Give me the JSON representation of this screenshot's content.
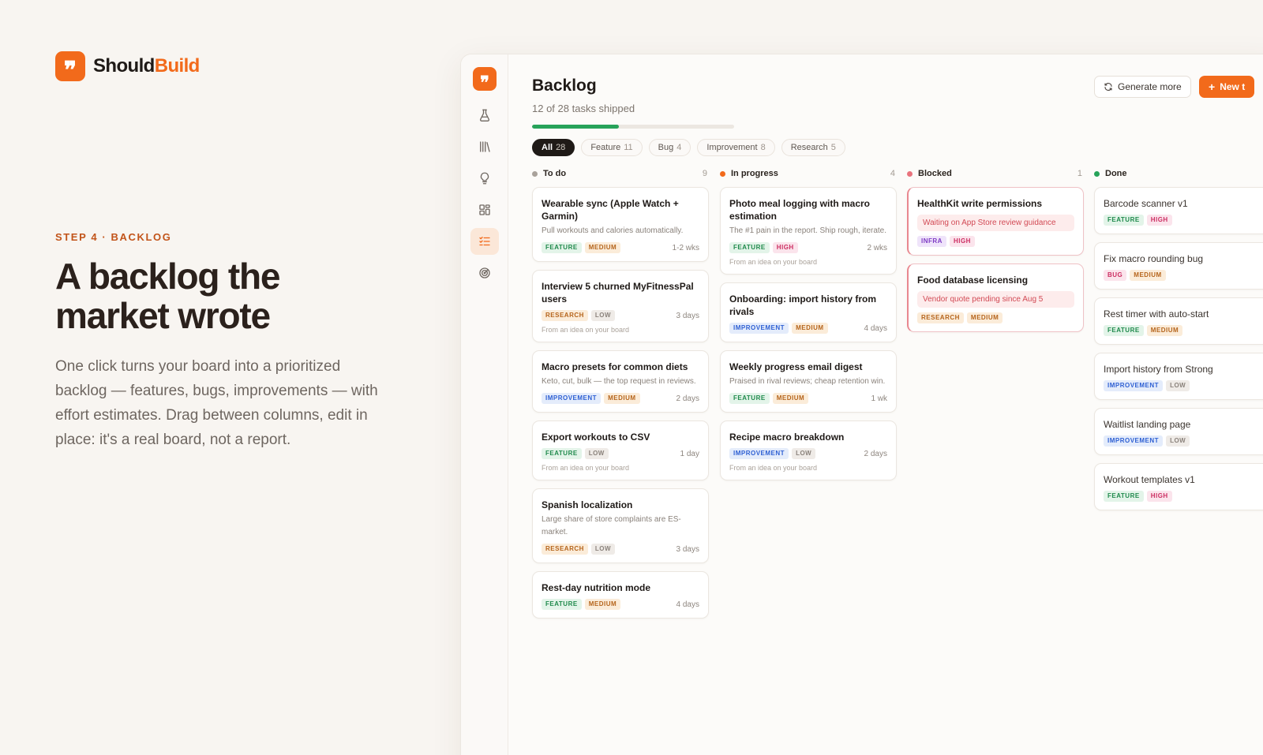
{
  "brand": {
    "name_main": "Should",
    "name_accent": "Build",
    "logo_glyph": "❞"
  },
  "hero": {
    "step": "STEP 4 · BACKLOG",
    "headline": "A backlog the market wrote",
    "lead": "One click turns your board into a prioritized backlog — features, bugs, improvements — with effort estimates. Drag between columns, edit in place: it's a real board, not a report."
  },
  "rail": {
    "logo_glyph": "❞",
    "items": [
      {
        "name": "rail-experiments",
        "icon": "flask-icon",
        "active": false
      },
      {
        "name": "rail-library",
        "icon": "library-icon",
        "active": false
      },
      {
        "name": "rail-ideas",
        "icon": "lightbulb-icon",
        "active": false
      },
      {
        "name": "rail-board",
        "icon": "grid-icon",
        "active": false
      },
      {
        "name": "rail-backlog",
        "icon": "checklist-icon",
        "active": true
      },
      {
        "name": "rail-radar",
        "icon": "radar-icon",
        "active": false
      }
    ]
  },
  "backlog": {
    "title": "Backlog",
    "subtitle": "12 of 28 tasks shipped",
    "shipped": 12,
    "total": 28,
    "generate_label": "Generate more",
    "new_label": "New t",
    "filters": [
      {
        "label": "All",
        "count": "28",
        "active": true
      },
      {
        "label": "Feature",
        "count": "11",
        "active": false
      },
      {
        "label": "Bug",
        "count": "4",
        "active": false
      },
      {
        "label": "Improvement",
        "count": "8",
        "active": false
      },
      {
        "label": "Research",
        "count": "5",
        "active": false
      }
    ]
  },
  "colors": {
    "accent": "#f26a1b",
    "badges": {
      "FEATURE": {
        "fg": "#1f8a4c",
        "bg": "#e3f4e9"
      },
      "RESEARCH": {
        "fg": "#b5641b",
        "bg": "#fbecd9"
      },
      "IMPROVEMENT": {
        "fg": "#2d5fd3",
        "bg": "#e4ecfb"
      },
      "BUG": {
        "fg": "#cc2e62",
        "bg": "#fbe4ec"
      },
      "INFRA": {
        "fg": "#7d3ac4",
        "bg": "#efe4fa"
      },
      "MEDIUM": {
        "fg": "#b5641b",
        "bg": "#fbecd9"
      },
      "LOW": {
        "fg": "#8a827b",
        "bg": "#efebe7"
      },
      "HIGH": {
        "fg": "#cc2e62",
        "bg": "#fbe4ec"
      }
    }
  },
  "columns": [
    {
      "key": "todo",
      "name": "To do",
      "count": "9",
      "dot": "#a9a29b",
      "cards": [
        {
          "title": "Wearable sync (Apple Watch + Garmin)",
          "desc": "Pull workouts and calories automatically.",
          "tags": [
            "FEATURE",
            "MEDIUM"
          ],
          "effort": "1-2 wks"
        },
        {
          "title": "Interview 5 churned MyFitnessPal users",
          "tags": [
            "RESEARCH",
            "LOW"
          ],
          "effort": "3 days",
          "source": "From an idea on your board"
        },
        {
          "title": "Macro presets for common diets",
          "desc": "Keto, cut, bulk — the top request in reviews.",
          "tags": [
            "IMPROVEMENT",
            "MEDIUM"
          ],
          "effort": "2 days"
        },
        {
          "title": "Export workouts to CSV",
          "tags": [
            "FEATURE",
            "LOW"
          ],
          "effort": "1 day",
          "source": "From an idea on your board"
        },
        {
          "title": "Spanish localization",
          "desc": "Large share of store complaints are ES-market.",
          "tags": [
            "RESEARCH",
            "LOW"
          ],
          "effort": "3 days"
        },
        {
          "title": "Rest-day nutrition mode",
          "tags": [
            "FEATURE",
            "MEDIUM"
          ],
          "effort": "4 days"
        }
      ]
    },
    {
      "key": "inprogress",
      "name": "In progress",
      "count": "4",
      "dot": "#f26a1b",
      "cards": [
        {
          "title": "Photo meal logging with macro estimation",
          "desc": "The #1 pain in the report. Ship rough, iterate.",
          "tags": [
            "FEATURE",
            "HIGH"
          ],
          "effort": "2 wks",
          "source": "From an idea on your board"
        },
        {
          "title": "Onboarding: import history from rivals",
          "tags": [
            "IMPROVEMENT",
            "MEDIUM"
          ],
          "effort": "4 days"
        },
        {
          "title": "Weekly progress email digest",
          "desc": "Praised in rival reviews; cheap retention win.",
          "tags": [
            "FEATURE",
            "MEDIUM"
          ],
          "effort": "1 wk"
        },
        {
          "title": "Recipe macro breakdown",
          "tags": [
            "IMPROVEMENT",
            "LOW"
          ],
          "effort": "2 days",
          "source": "From an idea on your board"
        }
      ]
    },
    {
      "key": "blocked",
      "name": "Blocked",
      "count": "1",
      "dot": "#e9737d",
      "cards": [
        {
          "title": "HealthKit write permissions",
          "note": "Waiting on App Store review guidance",
          "tags": [
            "INFRA",
            "HIGH"
          ]
        },
        {
          "title": "Food database licensing",
          "note": "Vendor quote pending since Aug 5",
          "tags": [
            "RESEARCH",
            "MEDIUM"
          ]
        }
      ]
    },
    {
      "key": "done",
      "name": "Done",
      "count": "",
      "dot": "#27a35a",
      "cards": [
        {
          "title": "Barcode scanner v1",
          "tags": [
            "FEATURE",
            "HIGH"
          ]
        },
        {
          "title": "Fix macro rounding bug",
          "tags": [
            "BUG",
            "MEDIUM"
          ]
        },
        {
          "title": "Rest timer with auto-start",
          "tags": [
            "FEATURE",
            "MEDIUM"
          ]
        },
        {
          "title": "Import history from Strong",
          "tags": [
            "IMPROVEMENT",
            "LOW"
          ]
        },
        {
          "title": "Waitlist landing page",
          "tags": [
            "IMPROVEMENT",
            "LOW"
          ]
        },
        {
          "title": "Workout templates v1",
          "tags": [
            "FEATURE",
            "HIGH"
          ]
        }
      ]
    }
  ]
}
